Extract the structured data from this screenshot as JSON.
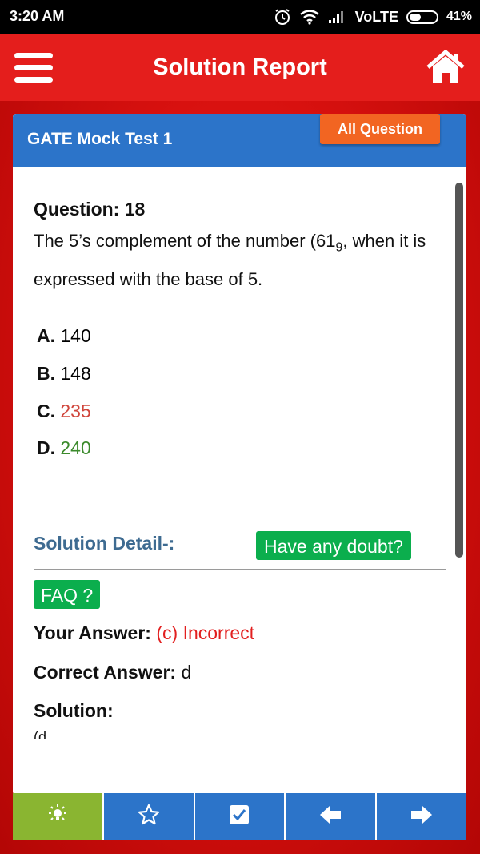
{
  "status": {
    "time": "3:20 AM",
    "network": "VoLTE",
    "battery": "41%"
  },
  "app": {
    "title": "Solution Report"
  },
  "card": {
    "test_name": "GATE Mock Test 1",
    "all_question_label": "All Question"
  },
  "question": {
    "number_label": "Question: 18",
    "text_before": "The 5’s complement of the number (61",
    "text_sub": "9",
    "text_after": ", when it is expressed with the base of 5.",
    "options": [
      {
        "letter": "A.",
        "text": "140",
        "state": "normal"
      },
      {
        "letter": "B.",
        "text": "148",
        "state": "normal"
      },
      {
        "letter": "C.",
        "text": "235",
        "state": "wrong"
      },
      {
        "letter": "D.",
        "text": "240",
        "state": "correct"
      }
    ]
  },
  "solution": {
    "heading": "Solution Detail-:",
    "doubt_label": "Have any doubt?",
    "faq_label": "FAQ ?",
    "your_answer_label": "Your Answer:",
    "your_answer_value": "(c) Incorrect",
    "correct_answer_label": "Correct Answer:",
    "correct_answer_value": "d",
    "solution_label": "Solution:",
    "solution_partial": "(d"
  },
  "colors": {
    "appbar": "#e41e1c",
    "header_blue": "#2c74c9",
    "accent_orange": "#f26522",
    "green_button": "#0bae4d",
    "wrong": "#d0453b",
    "correct": "#3b8a2b"
  },
  "bottom_nav": [
    {
      "icon": "bulb-icon",
      "active": true
    },
    {
      "icon": "star-icon",
      "active": false
    },
    {
      "icon": "checkbox-icon",
      "active": false
    },
    {
      "icon": "arrow-left-icon",
      "active": false
    },
    {
      "icon": "arrow-right-icon",
      "active": false
    }
  ]
}
